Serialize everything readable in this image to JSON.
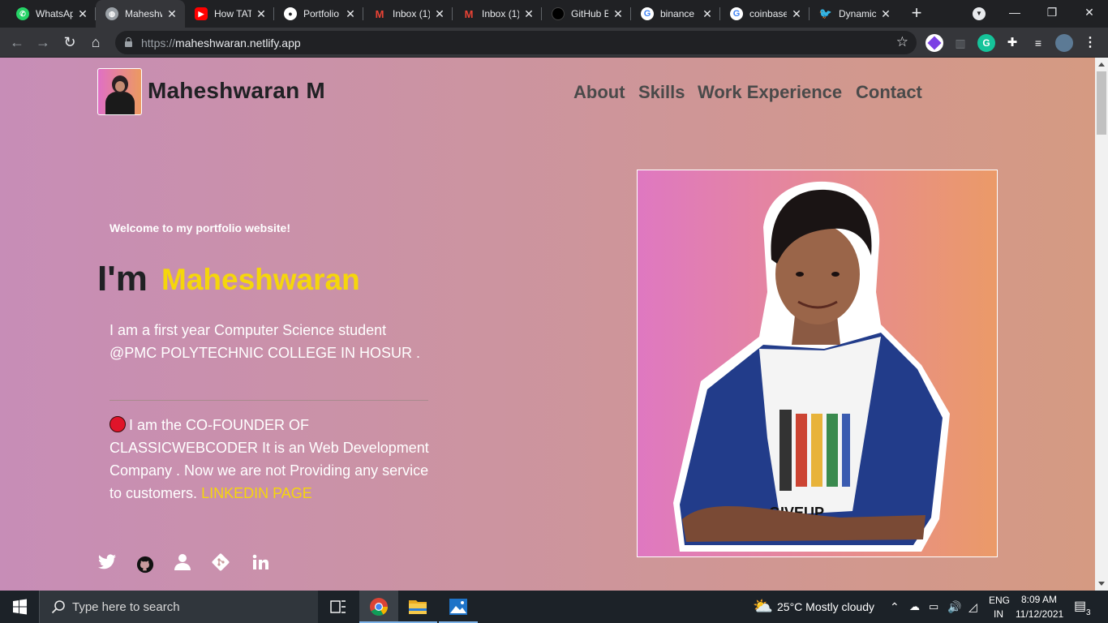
{
  "browser": {
    "tabs": [
      {
        "title": "WhatsApp",
        "icon": "whatsapp-icon",
        "color": "#25d366"
      },
      {
        "title": "Maheshwaran",
        "icon": "globe-icon",
        "color": "#9aa0a6",
        "active": true
      },
      {
        "title": "How TATA",
        "icon": "youtube-icon",
        "color": "#ff0000"
      },
      {
        "title": "Portfolio",
        "icon": "github-icon",
        "color": "#ffffff"
      },
      {
        "title": "Inbox (1)",
        "icon": "gmail-icon",
        "color": "#ea4335"
      },
      {
        "title": "Inbox (1)",
        "icon": "gmail-icon",
        "color": "#ea4335"
      },
      {
        "title": "GitHub E",
        "icon": "github-icon",
        "color": "#000000"
      },
      {
        "title": "binance",
        "icon": "google-icon",
        "color": "#4285f4"
      },
      {
        "title": "coinbase",
        "icon": "google-icon",
        "color": "#4285f4"
      },
      {
        "title": "Dynamic",
        "icon": "twitter-icon",
        "color": "#1da1f2"
      }
    ],
    "url_scheme": "https://",
    "url_host": "maheshwaran.netlify.app"
  },
  "site": {
    "brand": "Maheshwaran M",
    "nav": [
      "About",
      "Skills",
      "Work Experience",
      "Contact"
    ],
    "welcome": "Welcome to my portfolio website!",
    "im": "I'm",
    "name": "Maheshwaran",
    "intro": "I am a first year Computer Science student @PMC POLYTECHNIC COLLEGE IN HOSUR .",
    "cofounder": "I am the CO-FOUNDER OF CLASSICWEBCODER It is an Web Development Company . Now we are not Providing any service to customers.",
    "linkedin_link": "LINKEDIN PAGE",
    "socials": [
      "twitter-icon",
      "github-icon",
      "user-icon",
      "git-icon",
      "linkedin-icon"
    ],
    "accent_color": "#f5d60c"
  },
  "taskbar": {
    "search_placeholder": "Type here to search",
    "weather": "25°C  Mostly cloudy",
    "lang_top": "ENG",
    "lang_bottom": "IN",
    "time": "8:09 AM",
    "date": "11/12/2021",
    "notification_count": "3"
  }
}
